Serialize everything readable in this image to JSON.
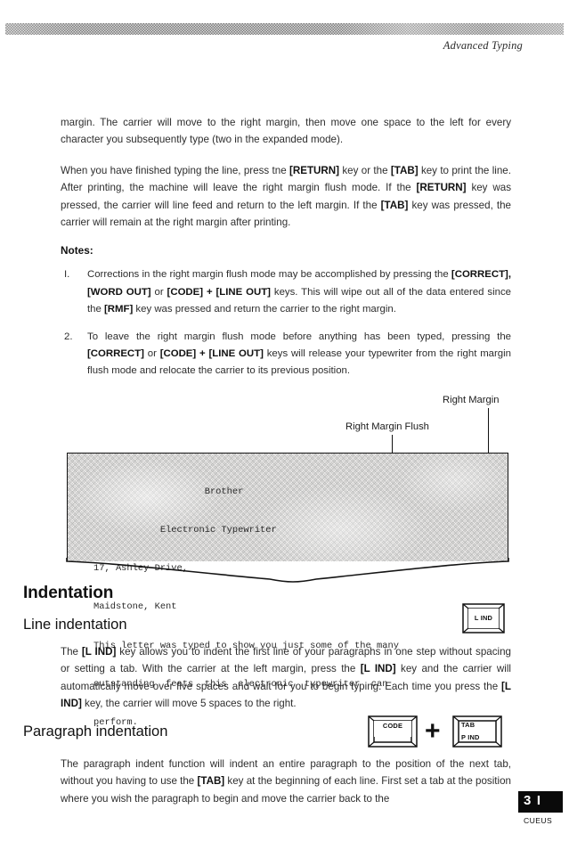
{
  "header": {
    "running_head": "Advanced Typing"
  },
  "body": {
    "paragraph_1_html": "margin. The carrier will move to the right margin, then move one space to the left for every character you subsequently type (two in the expanded mode).",
    "paragraph_2_parts": [
      "When you have finished typing the line, press tne ",
      "[RETURN]",
      " key or the ",
      "[TAB]",
      " key to print the line. After printing, the machine will leave the right margin flush mode. If the ",
      "[RETURN]",
      " key was pressed, the carrier will line feed and return to the left margin. If the ",
      "[TAB]",
      " key was pressed, the carrier will remain at the right margin after printing."
    ]
  },
  "notes": {
    "heading": "Notes:",
    "items": [
      {
        "number": "I.",
        "parts": [
          "Corrections in the right margin flush mode may be accomplished by pressing the ",
          "[CORRECT], [WORD OUT]",
          " or ",
          "[CODE] + [LINE OUT]",
          " keys. This will wipe out all of the data entered since the ",
          "[RMF]",
          " key was pressed and return the carrier to the right margin."
        ]
      },
      {
        "number": "2.",
        "parts": [
          "To leave the right margin flush mode before anything has been typed, pressing the ",
          "[CORRECT]",
          " or ",
          "[CODE] + [LINE OUT]",
          " keys will release your typewriter from the right margin flush mode and relocate the carrier to its previous position."
        ]
      }
    ]
  },
  "figure": {
    "callout_right_margin": "Right Margin",
    "callout_right_margin_flush": "Right Margin Flush",
    "sample_lines": [
      "                    Brother",
      "            Electronic Typewriter",
      "17, Ashley Drive,",
      "Maidstone, Kent",
      "This letter was typed to show you just some of the many",
      "outstanding  feats  this  electronic  typewriter  can",
      "perform."
    ]
  },
  "sections": {
    "indentation_heading": "Indentation",
    "line_indentation_heading": "Line indentation",
    "line_indentation_parts": [
      "The ",
      "[L IND]",
      " key allows you to indent the first line of your paragraphs in one step without spacing or setting a tab. With the carrier at the left margin, press the ",
      "[L IND]",
      " key and the carrier will automatically move over five spaces and wait for you to begin typing. Each time you press the ",
      "[L IND]",
      " key, the carrier will move 5 spaces to the right."
    ],
    "paragraph_indentation_heading": "Paragraph indentation",
    "paragraph_indentation_parts": [
      "The paragraph indent function will indent an entire paragraph to the position of the next tab, without you having to use the ",
      "[TAB]",
      " key at the beginning of each line. First set a tab at the position where you wish the paragraph to begin and move  the carrier back to the"
    ]
  },
  "keys": {
    "l_ind": "L IND",
    "code": "CODE",
    "tab_top": "TAB",
    "tab_bottom": "P IND",
    "plus": "+"
  },
  "footer": {
    "page_number": "3 I",
    "imprint": "CUEUS"
  },
  "colors": {
    "ink": "#1a1a1a",
    "band": "#6e6e6e",
    "pagenum_bg": "#0a0a0a"
  }
}
